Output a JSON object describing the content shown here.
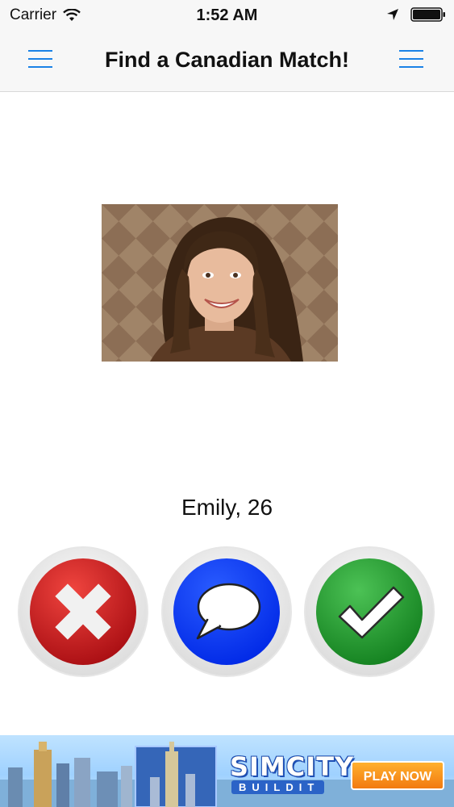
{
  "status_bar": {
    "carrier": "Carrier",
    "time": "1:52 AM",
    "icons": [
      "wifi-icon",
      "location-arrow-icon",
      "battery-icon"
    ]
  },
  "nav": {
    "title": "Find a Canadian Match!",
    "left_icon": "hamburger-menu-icon",
    "right_icon": "hamburger-menu-icon",
    "accent_color": "#1a82e6"
  },
  "profile": {
    "name_age": "Emily, 26",
    "photo": "profile-photo"
  },
  "actions": [
    {
      "name": "dislike",
      "icon": "x-icon",
      "color": "#c9161c"
    },
    {
      "name": "message",
      "icon": "speech-bubble-icon",
      "color": "#0a3dff"
    },
    {
      "name": "like",
      "icon": "checkmark-icon",
      "color": "#1e9a2e"
    }
  ],
  "ad": {
    "brand": "SIMCITY",
    "sub": "BUILDIT",
    "cta": "PLAY NOW"
  }
}
